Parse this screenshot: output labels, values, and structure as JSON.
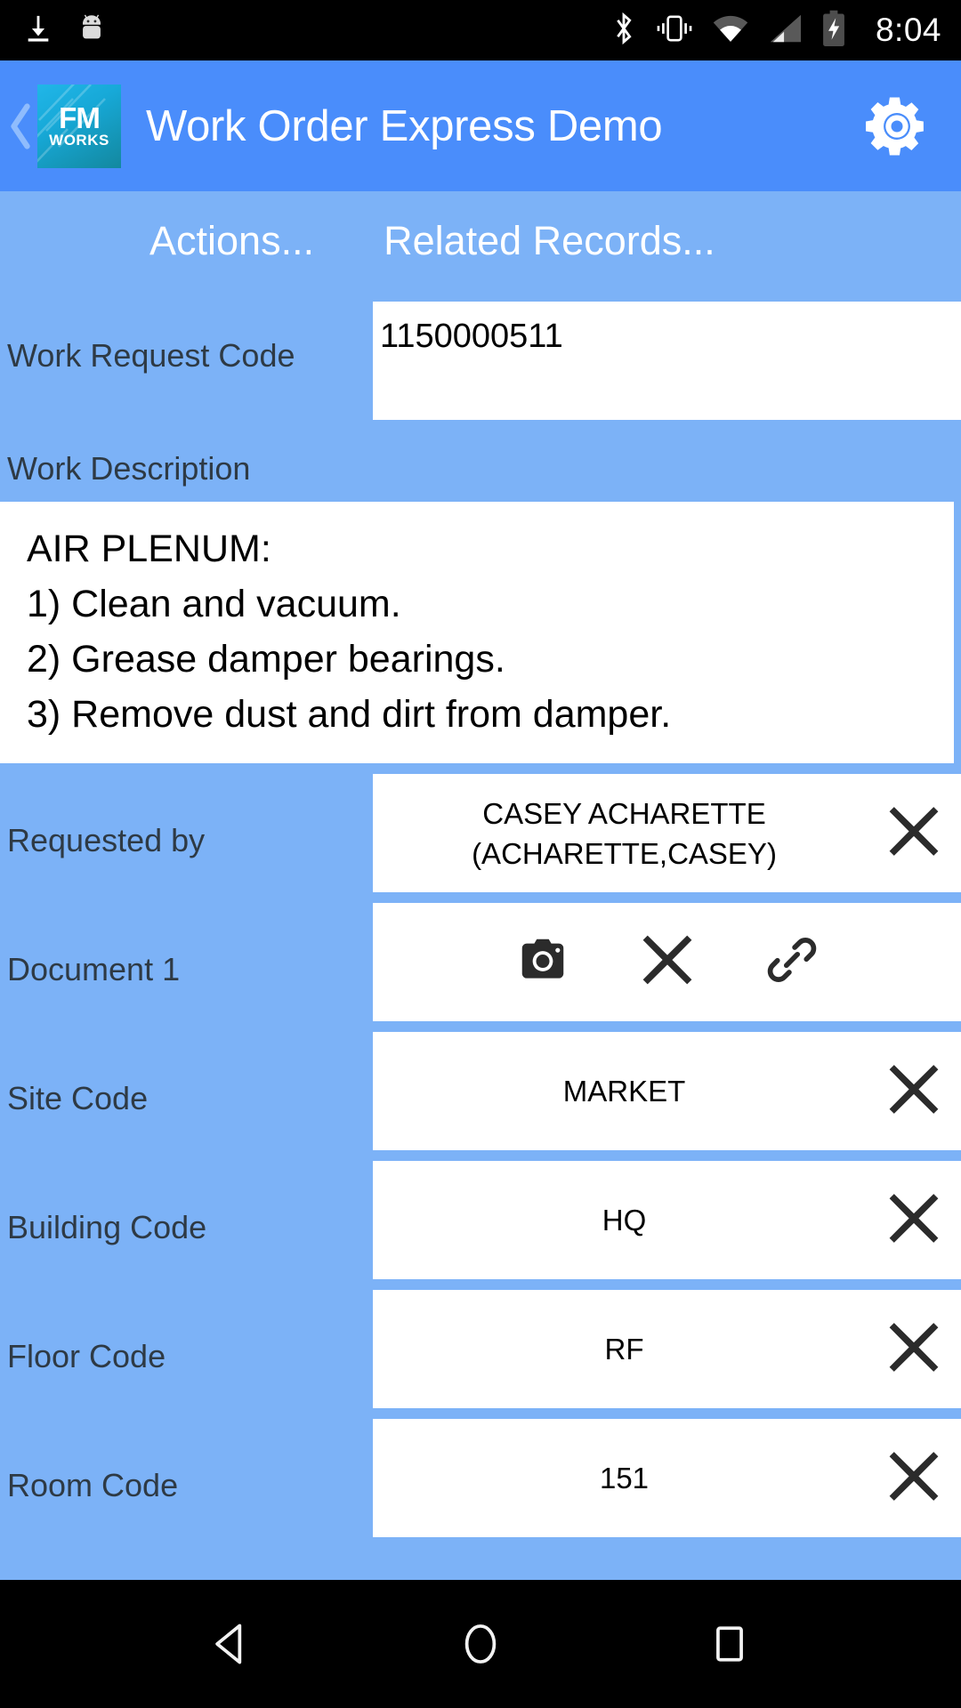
{
  "statusbar": {
    "time": "8:04",
    "icons": [
      "download-icon",
      "android-mascot-icon",
      "bluetooth-icon",
      "vibrate-icon",
      "wifi-icon",
      "cellular-signal-icon",
      "battery-charging-icon"
    ]
  },
  "appbar": {
    "back_label": "back-chevron",
    "logo_primary": "FM",
    "logo_secondary": "WORKS",
    "title": "Work Order Express Demo",
    "settings_icon": "gear-icon"
  },
  "tabs": [
    {
      "label": "Actions...",
      "name": "tab-actions"
    },
    {
      "label": "Related Records...",
      "name": "tab-related-records"
    }
  ],
  "form": {
    "work_request_code": {
      "label": "Work Request Code",
      "value": "1150000511"
    },
    "work_description": {
      "label": "Work Description",
      "value": "AIR PLENUM:\n1) Clean and vacuum.\n2) Grease damper bearings.\n3) Remove dust and dirt from damper."
    },
    "requested_by": {
      "label": "Requested by",
      "value": "CASEY ACHARETTE\n(ACHARETTE,CASEY)",
      "line1": "CASEY ACHARETTE",
      "line2": "(ACHARETTE,CASEY)",
      "clear_icon": "clear-x-icon"
    },
    "document_1": {
      "label": "Document 1",
      "actions": [
        "camera-icon",
        "clear-x-icon",
        "link-icon"
      ]
    },
    "site_code": {
      "label": "Site Code",
      "value": "MARKET",
      "clear_icon": "clear-x-icon"
    },
    "building_code": {
      "label": "Building Code",
      "value": "HQ",
      "clear_icon": "clear-x-icon"
    },
    "floor_code": {
      "label": "Floor Code",
      "value": "RF",
      "clear_icon": "clear-x-icon"
    },
    "room_code": {
      "label": "Room Code",
      "value": "151",
      "clear_icon": "clear-x-icon"
    }
  },
  "navbar": {
    "back": "back-triangle-icon",
    "home": "home-circle-icon",
    "recents": "recents-square-icon"
  },
  "colors": {
    "appbar_blue": "#4a8dfb",
    "content_blue": "#7cb2f7",
    "field_white": "#ffffff",
    "label_text": "#2e3a45",
    "statusbar_black": "#000000",
    "logo_teal": "#17a9d8"
  }
}
